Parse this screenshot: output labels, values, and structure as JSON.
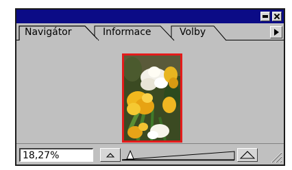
{
  "window": {
    "title": "",
    "minimize_icon": "minimize-icon",
    "close_icon": "close-icon",
    "title_bar_color": "#0b0b86"
  },
  "tabs": [
    {
      "label": "Navigátor",
      "active": true
    },
    {
      "label": "Informace",
      "active": false
    },
    {
      "label": "Volby",
      "active": false
    }
  ],
  "palette_menu_icon": "triangle-right-icon",
  "thumbnail": {
    "view_box_color": "#e31b1b"
  },
  "zoom": {
    "value": "18,27%",
    "zoom_out_icon": "small-mountain-icon",
    "zoom_in_icon": "large-mountain-icon",
    "slider_level": 0.04
  }
}
